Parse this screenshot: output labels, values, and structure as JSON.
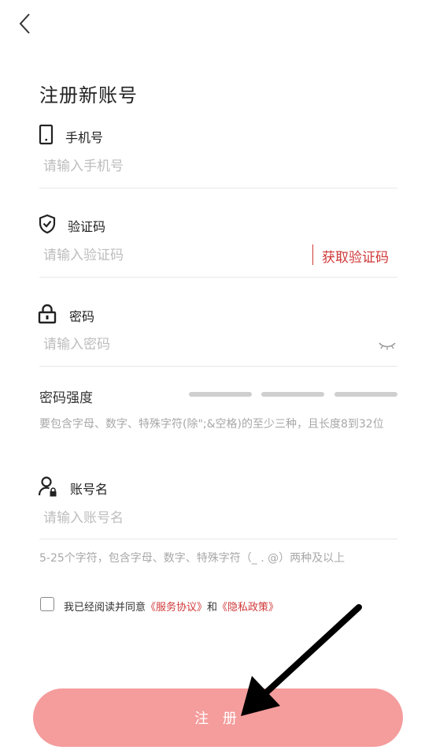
{
  "page_title": "注册新账号",
  "phone": {
    "label": "手机号",
    "placeholder": "请输入手机号"
  },
  "code": {
    "label": "验证码",
    "placeholder": "请输入验证码",
    "get_code": "获取验证码"
  },
  "password": {
    "label": "密码",
    "placeholder": "请输入密码"
  },
  "strength": {
    "label": "密码强度",
    "hint": "要包含字母、数字、特殊字符(除\";&空格)的至少三种，且长度8到32位"
  },
  "account": {
    "label": "账号名",
    "placeholder": "请输入账号名",
    "hint": "5-25个字符，包含字母、数字、特殊字符（_ . @）两种及以上"
  },
  "agreement": {
    "prefix": "我已经阅读并同意",
    "service": "《服务协议》",
    "conj": "和",
    "privacy": "《隐私政策》",
    "checked": false
  },
  "register_label": "注 册",
  "colors": {
    "accent": "#d03838",
    "button": "#f59c9c"
  },
  "icons": [
    "back-arrow-icon",
    "phone-icon",
    "shield-check-icon",
    "lock-icon",
    "eye-closed-icon",
    "user-lock-icon",
    "arrow-pointer-icon"
  ]
}
